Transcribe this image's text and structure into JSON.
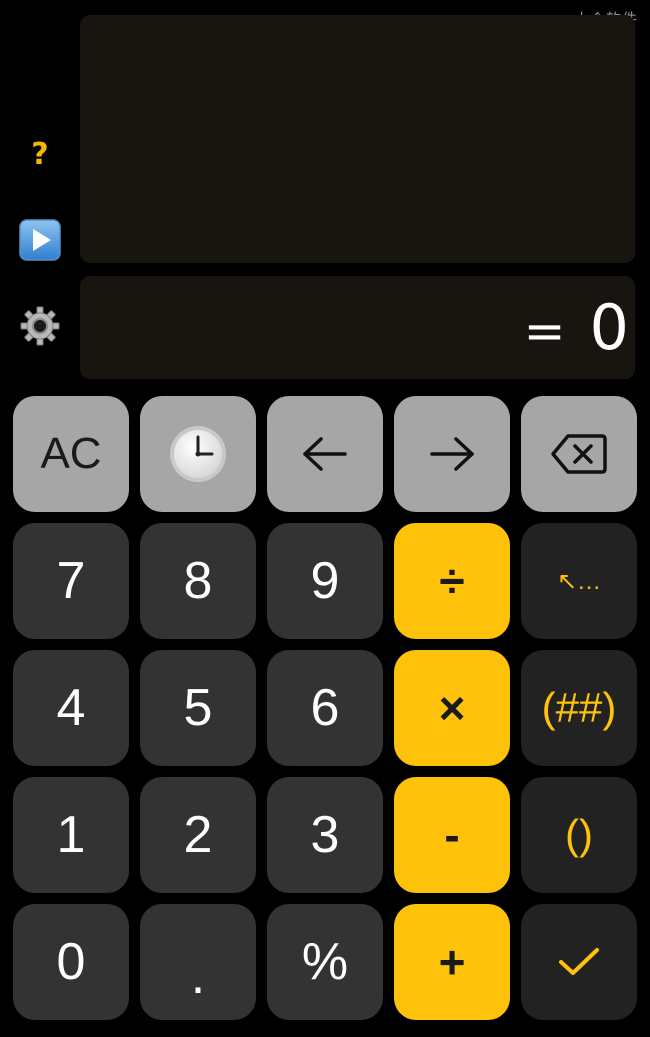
{
  "watermark": "小众软件",
  "side_icons": {
    "help": "?",
    "play": "play-icon",
    "settings": "gear-icon"
  },
  "display": {
    "history_text": "",
    "result_prefix": "=",
    "result_value": "0"
  },
  "keys": {
    "clear": "AC",
    "history": "clock-icon",
    "cursor_left": "←",
    "cursor_right": "→",
    "backspace": "backspace-icon",
    "seven": "7",
    "eight": "8",
    "nine": "9",
    "divide": "÷",
    "previous_answer": "↖...",
    "four": "4",
    "five": "5",
    "six": "6",
    "multiply": "×",
    "paren_wrap": "(##)",
    "one": "1",
    "two": "2",
    "three": "3",
    "minus": "-",
    "parens": "()",
    "zero": "0",
    "decimal": ".",
    "percent": "%",
    "plus": "+",
    "confirm": "✓"
  },
  "colors": {
    "accent": "#ffc20a",
    "key_dark": "#333333",
    "key_gray": "#a6a6a6",
    "display_bg": "#181510"
  }
}
